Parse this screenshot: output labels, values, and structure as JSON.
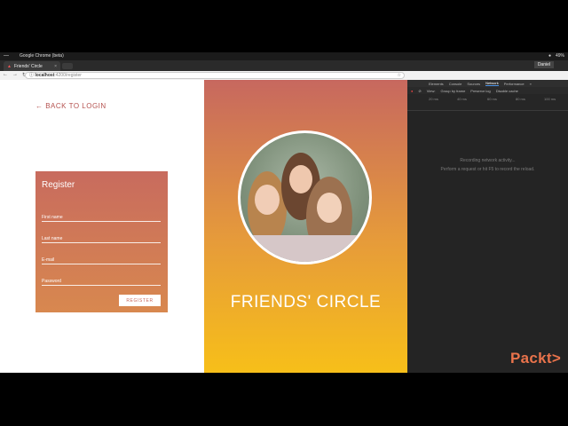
{
  "os_bar": {
    "menu_glyph": "—",
    "window_title": "Google Chrome (beta)",
    "tray": {
      "battery": "49%",
      "time": "",
      "user": "Daniel"
    }
  },
  "browser": {
    "tab_title": "Friends' Circle",
    "tab_close": "×",
    "address": {
      "host": "localhost",
      "path": ":4200/register"
    }
  },
  "app": {
    "back_link": "← BACK TO LOGIN",
    "register": {
      "heading": "Register",
      "fields": [
        {
          "label": "First name"
        },
        {
          "label": "Last name"
        },
        {
          "label": "E-mail"
        },
        {
          "label": "Password"
        }
      ],
      "submit_label": "REGISTER"
    },
    "brand_title": "FRIENDS' CIRCLE"
  },
  "devtools": {
    "tabs": [
      "Elements",
      "Console",
      "Sources",
      "Network",
      "Performance",
      "»"
    ],
    "active_tab": "Network",
    "toolbar": [
      "View:",
      "Group by frame",
      "Preserve log",
      "Disable cache"
    ],
    "timeline_ticks": [
      "20 ms",
      "40 ms",
      "60 ms",
      "80 ms",
      "100 ms"
    ],
    "empty_line1": "Recording network activity...",
    "empty_line2": "Perform a request or hit F5 to record the reload."
  },
  "watermark": "Packt>",
  "colors": {
    "accent_red": "#c8695d",
    "gradient_top": "#c7685f",
    "gradient_bottom": "#f7bf19",
    "packt": "#e9734b"
  }
}
